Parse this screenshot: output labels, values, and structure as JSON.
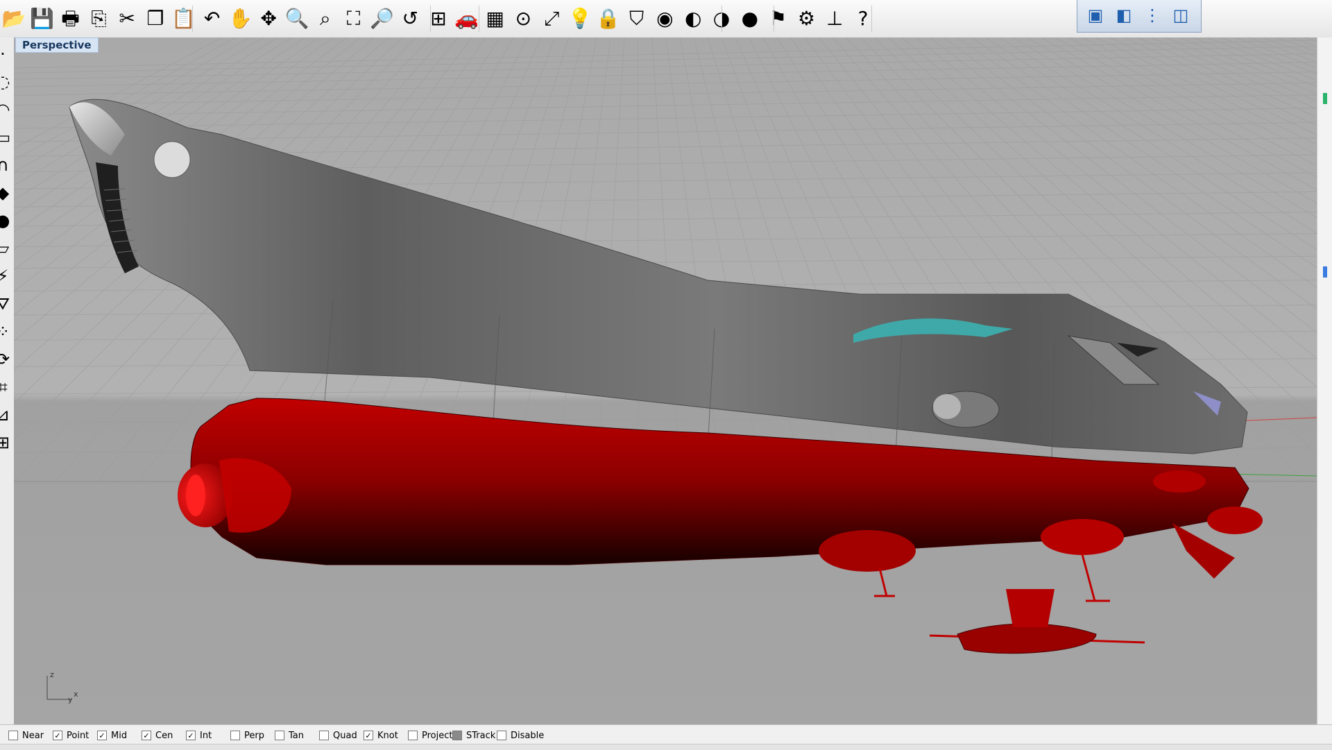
{
  "viewport": {
    "label": "Perspective"
  },
  "axis": {
    "z": "z",
    "y": "y",
    "x": "x"
  },
  "toolbar": {
    "icons": [
      "open-icon",
      "save-icon",
      "print-icon",
      "export-icon",
      "cut-icon",
      "copy-icon",
      "paste-icon",
      "undo-icon",
      "pan-hand-icon",
      "rotate-view-icon",
      "zoom-icon",
      "zoom-window-icon",
      "zoom-extents-icon",
      "zoom-selected-icon",
      "undo-view-icon",
      "four-viewports-icon",
      "car-icon",
      "plane-grid-icon",
      "osnap-icon",
      "gumball-icon",
      "light-bulb-icon",
      "lock-icon",
      "layer-icon",
      "color-wheel-icon",
      "shaded-sphere-icon",
      "rendered-sphere-icon",
      "blue-sphere-icon",
      "pointer-flag-icon",
      "settings-gear-icon",
      "dimension-icon",
      "help-icon"
    ],
    "glyphs": [
      "📂",
      "💾",
      "🖶",
      "⎘",
      "✂",
      "❐",
      "📋",
      "↶",
      "✋",
      "✥",
      "🔍",
      "⌕",
      "⛶",
      "🔎",
      "↺",
      "⊞",
      "🚗",
      "▦",
      "⊙",
      "⤢",
      "💡",
      "🔒",
      "⛉",
      "◉",
      "◐",
      "◑",
      "●",
      "⚑",
      "⚙",
      "⊥",
      "?"
    ]
  },
  "viewbar": {
    "icons": [
      "box-view-icon",
      "named-view-icon",
      "split-view-icon",
      "viewport-icon"
    ],
    "glyphs": [
      "▣",
      "◧",
      "⋮",
      "◫"
    ]
  },
  "lefttools": {
    "icons": [
      "point-icon",
      "circle-icon",
      "arc-icon",
      "rectangle-icon",
      "curve-icon",
      "surface-icon",
      "solid-icon",
      "mesh-icon",
      "transform-icon",
      "dimension-icon",
      "array-icon",
      "analyze-icon",
      "edit-icon",
      "measure-icon",
      "scale-icon"
    ],
    "glyphs": [
      "·",
      "◌",
      "◠",
      "▭",
      "∩",
      "◆",
      "●",
      "▱",
      "⚡",
      "⛛",
      "⁘",
      "⟳",
      "⌗",
      "⊿",
      "⊞"
    ]
  },
  "snaps": [
    {
      "label": "Near",
      "checked": false
    },
    {
      "label": "Point",
      "checked": true
    },
    {
      "label": "Mid",
      "checked": true
    },
    {
      "label": "Cen",
      "checked": true
    },
    {
      "label": "Int",
      "checked": true
    },
    {
      "label": "Perp",
      "checked": false
    },
    {
      "label": "Tan",
      "checked": false
    },
    {
      "label": "Quad",
      "checked": false
    },
    {
      "label": "Knot",
      "checked": true
    },
    {
      "label": "Project",
      "checked": false
    },
    {
      "label": "STrack",
      "checked": true
    },
    {
      "label": "Disable",
      "checked": false
    }
  ],
  "colors": {
    "hull_grey": "#6e6e6e",
    "hull_red": "#b30000",
    "grid_line": "#a8a8a8",
    "viewport_bg": "#a2a2a2"
  }
}
